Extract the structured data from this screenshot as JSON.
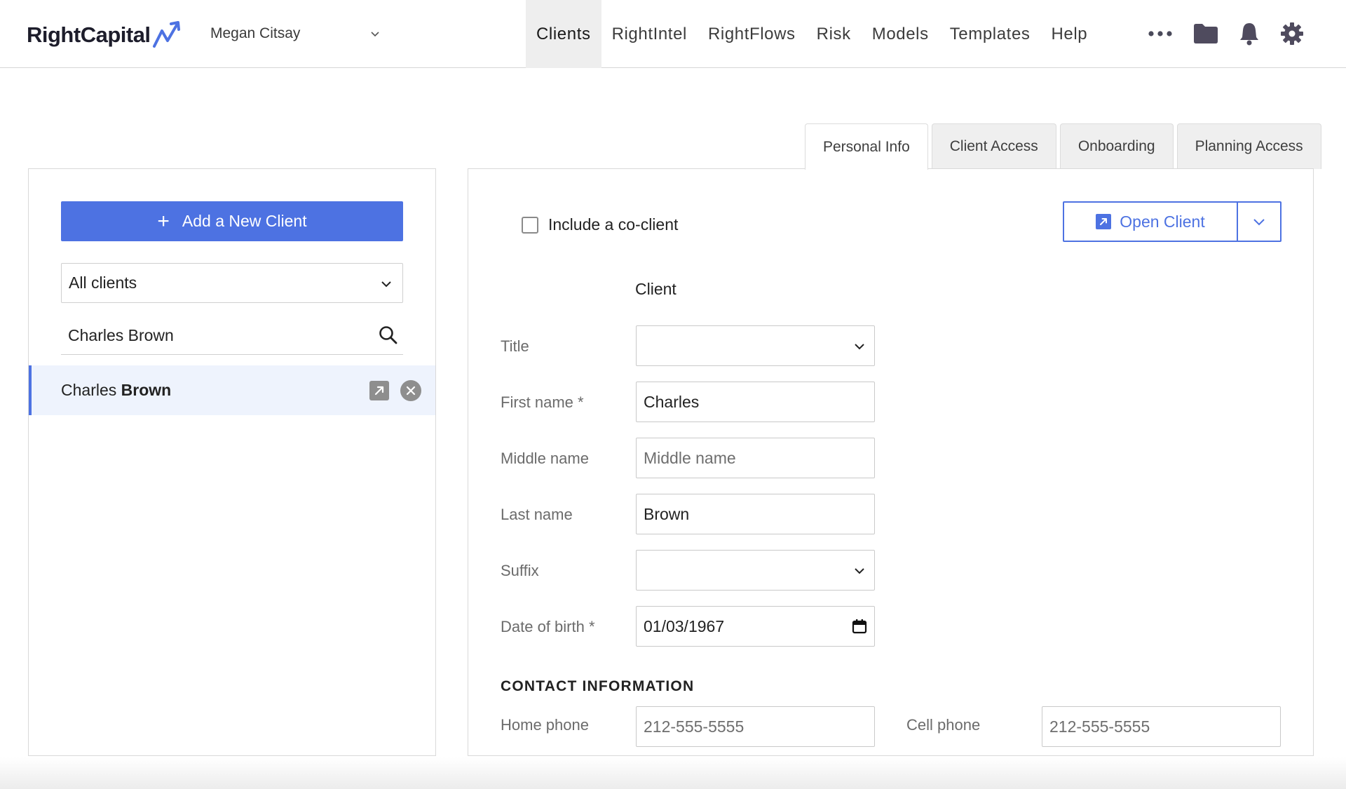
{
  "app": {
    "logo_text": "RightCapital",
    "advisor_name": "Megan Citsay",
    "accent_color": "#4d72e2"
  },
  "nav": {
    "items": [
      {
        "label": "Clients",
        "active": true
      },
      {
        "label": "RightIntel"
      },
      {
        "label": "RightFlows"
      },
      {
        "label": "Risk"
      },
      {
        "label": "Models"
      },
      {
        "label": "Templates"
      },
      {
        "label": "Help"
      }
    ],
    "icons": [
      "more-icon",
      "folder-icon",
      "bell-icon",
      "gear-icon"
    ]
  },
  "tabs": [
    {
      "label": "Personal Info",
      "active": true
    },
    {
      "label": "Client Access"
    },
    {
      "label": "Onboarding"
    },
    {
      "label": "Planning Access"
    }
  ],
  "sidebar": {
    "add_button_label": "Add a New Client",
    "filter_value": "All clients",
    "search_value": "Charles Brown",
    "clients": [
      {
        "first": "Charles",
        "last": "Brown"
      }
    ]
  },
  "form": {
    "coclient_label": "Include a co-client",
    "open_button_label": "Open Client",
    "column_header": "Client",
    "fields": {
      "title": {
        "label": "Title",
        "value": ""
      },
      "first_name": {
        "label": "First name *",
        "value": "Charles"
      },
      "middle_name": {
        "label": "Middle name",
        "value": "",
        "placeholder": "Middle name"
      },
      "last_name": {
        "label": "Last name",
        "value": "Brown"
      },
      "suffix": {
        "label": "Suffix",
        "value": ""
      },
      "dob": {
        "label": "Date of birth *",
        "value": "01/03/1967"
      }
    },
    "contact": {
      "section_title": "CONTACT INFORMATION",
      "home_phone": {
        "label": "Home phone",
        "placeholder": "212-555-5555"
      },
      "cell_phone": {
        "label": "Cell phone",
        "placeholder": "212-555-5555"
      }
    }
  }
}
